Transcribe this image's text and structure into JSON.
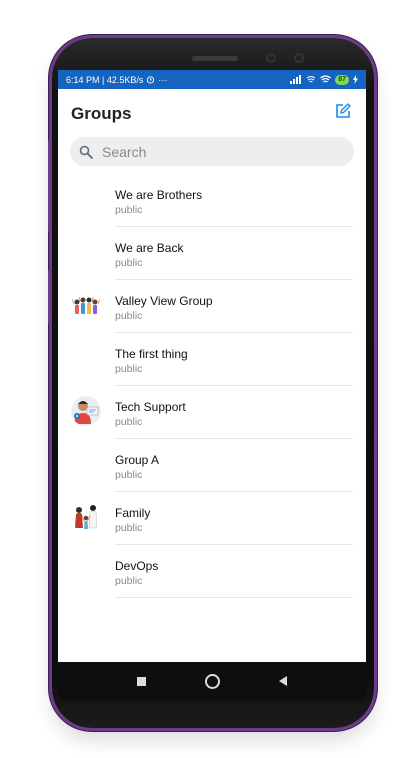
{
  "status_bar": {
    "time_speed": "6:14 PM | 42.5KB/s",
    "battery": "87"
  },
  "header": {
    "title": "Groups"
  },
  "search": {
    "placeholder": "Search"
  },
  "groups": [
    {
      "name": "We are Brothers",
      "type": "public",
      "avatar": "none"
    },
    {
      "name": "We are Back",
      "type": "public",
      "avatar": "none"
    },
    {
      "name": "Valley View Group",
      "type": "public",
      "avatar": "people-group-icon"
    },
    {
      "name": "The first thing",
      "type": "public",
      "avatar": "none"
    },
    {
      "name": "Tech Support",
      "type": "public",
      "avatar": "tech-support-icon"
    },
    {
      "name": "Group A",
      "type": "public",
      "avatar": "none"
    },
    {
      "name": "Family",
      "type": "public",
      "avatar": "family-icon"
    },
    {
      "name": "DevOps",
      "type": "public",
      "avatar": "none"
    }
  ],
  "colors": {
    "status_bar": "#1565c0",
    "accent": "#1e88e5",
    "phone_frame": "#6b3b8c"
  }
}
